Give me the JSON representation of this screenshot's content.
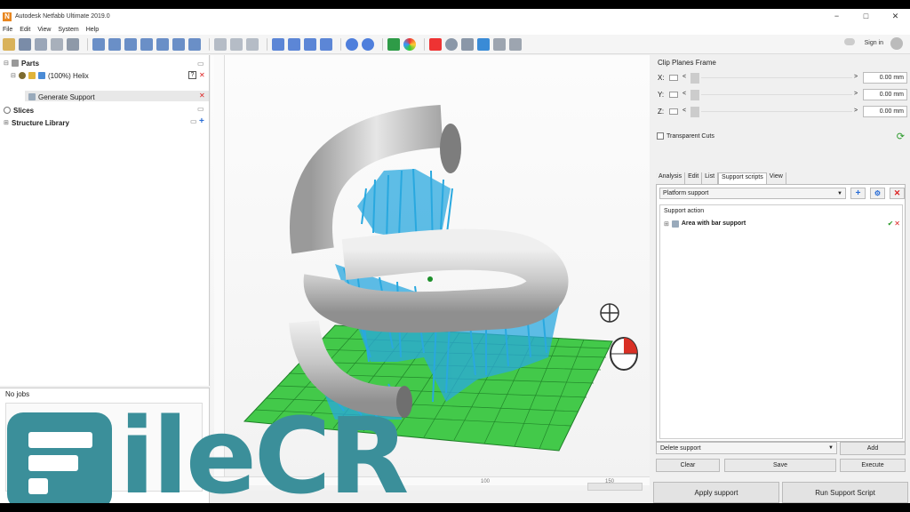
{
  "window": {
    "title": "Autodesk Netfabb Ultimate 2019.0",
    "logo_letter": "N",
    "controls": [
      "−",
      "□",
      "✕"
    ]
  },
  "menu": [
    "File",
    "Edit",
    "View",
    "System",
    "Help"
  ],
  "toolbar": {
    "signin_label": "Sign in"
  },
  "tree": {
    "parts": "Parts",
    "part_item": "(100%) Helix",
    "support_item": "Generate Support",
    "slices": "Slices",
    "library": "Structure Library",
    "part_status_icon": "?",
    "delete_icon": "✕"
  },
  "jobs": {
    "label": "No jobs"
  },
  "viewport": {
    "ruler_ticks": [
      "100",
      "150"
    ],
    "colors": {
      "platform": "#43c94a",
      "support": "#29a8df",
      "helix": "#c8c8c8"
    }
  },
  "clip": {
    "title": "Clip Planes Frame",
    "rows": [
      {
        "axis": "X:",
        "lt": "<",
        "gt": ">",
        "value": "0.00 mm"
      },
      {
        "axis": "Y:",
        "lt": "<",
        "gt": ">",
        "value": "0.00 mm"
      },
      {
        "axis": "Z:",
        "lt": "<",
        "gt": ">",
        "value": "0.00 mm"
      }
    ],
    "transparent_cuts": "Transparent Cuts"
  },
  "tabs": [
    "Analysis",
    "Edit",
    "List",
    "Support scripts",
    "View"
  ],
  "support": {
    "platform_select": "Platform support",
    "action_header": "Support action",
    "action_item": "Area with bar support",
    "delete_select": "Delete support",
    "add_btn": "Add",
    "clear_btn": "Clear",
    "save_btn": "Save",
    "execute_btn": "Execute",
    "apply_btn": "Apply support",
    "run_btn": "Run Support Script"
  },
  "watermark": {
    "text": "ileCR"
  }
}
